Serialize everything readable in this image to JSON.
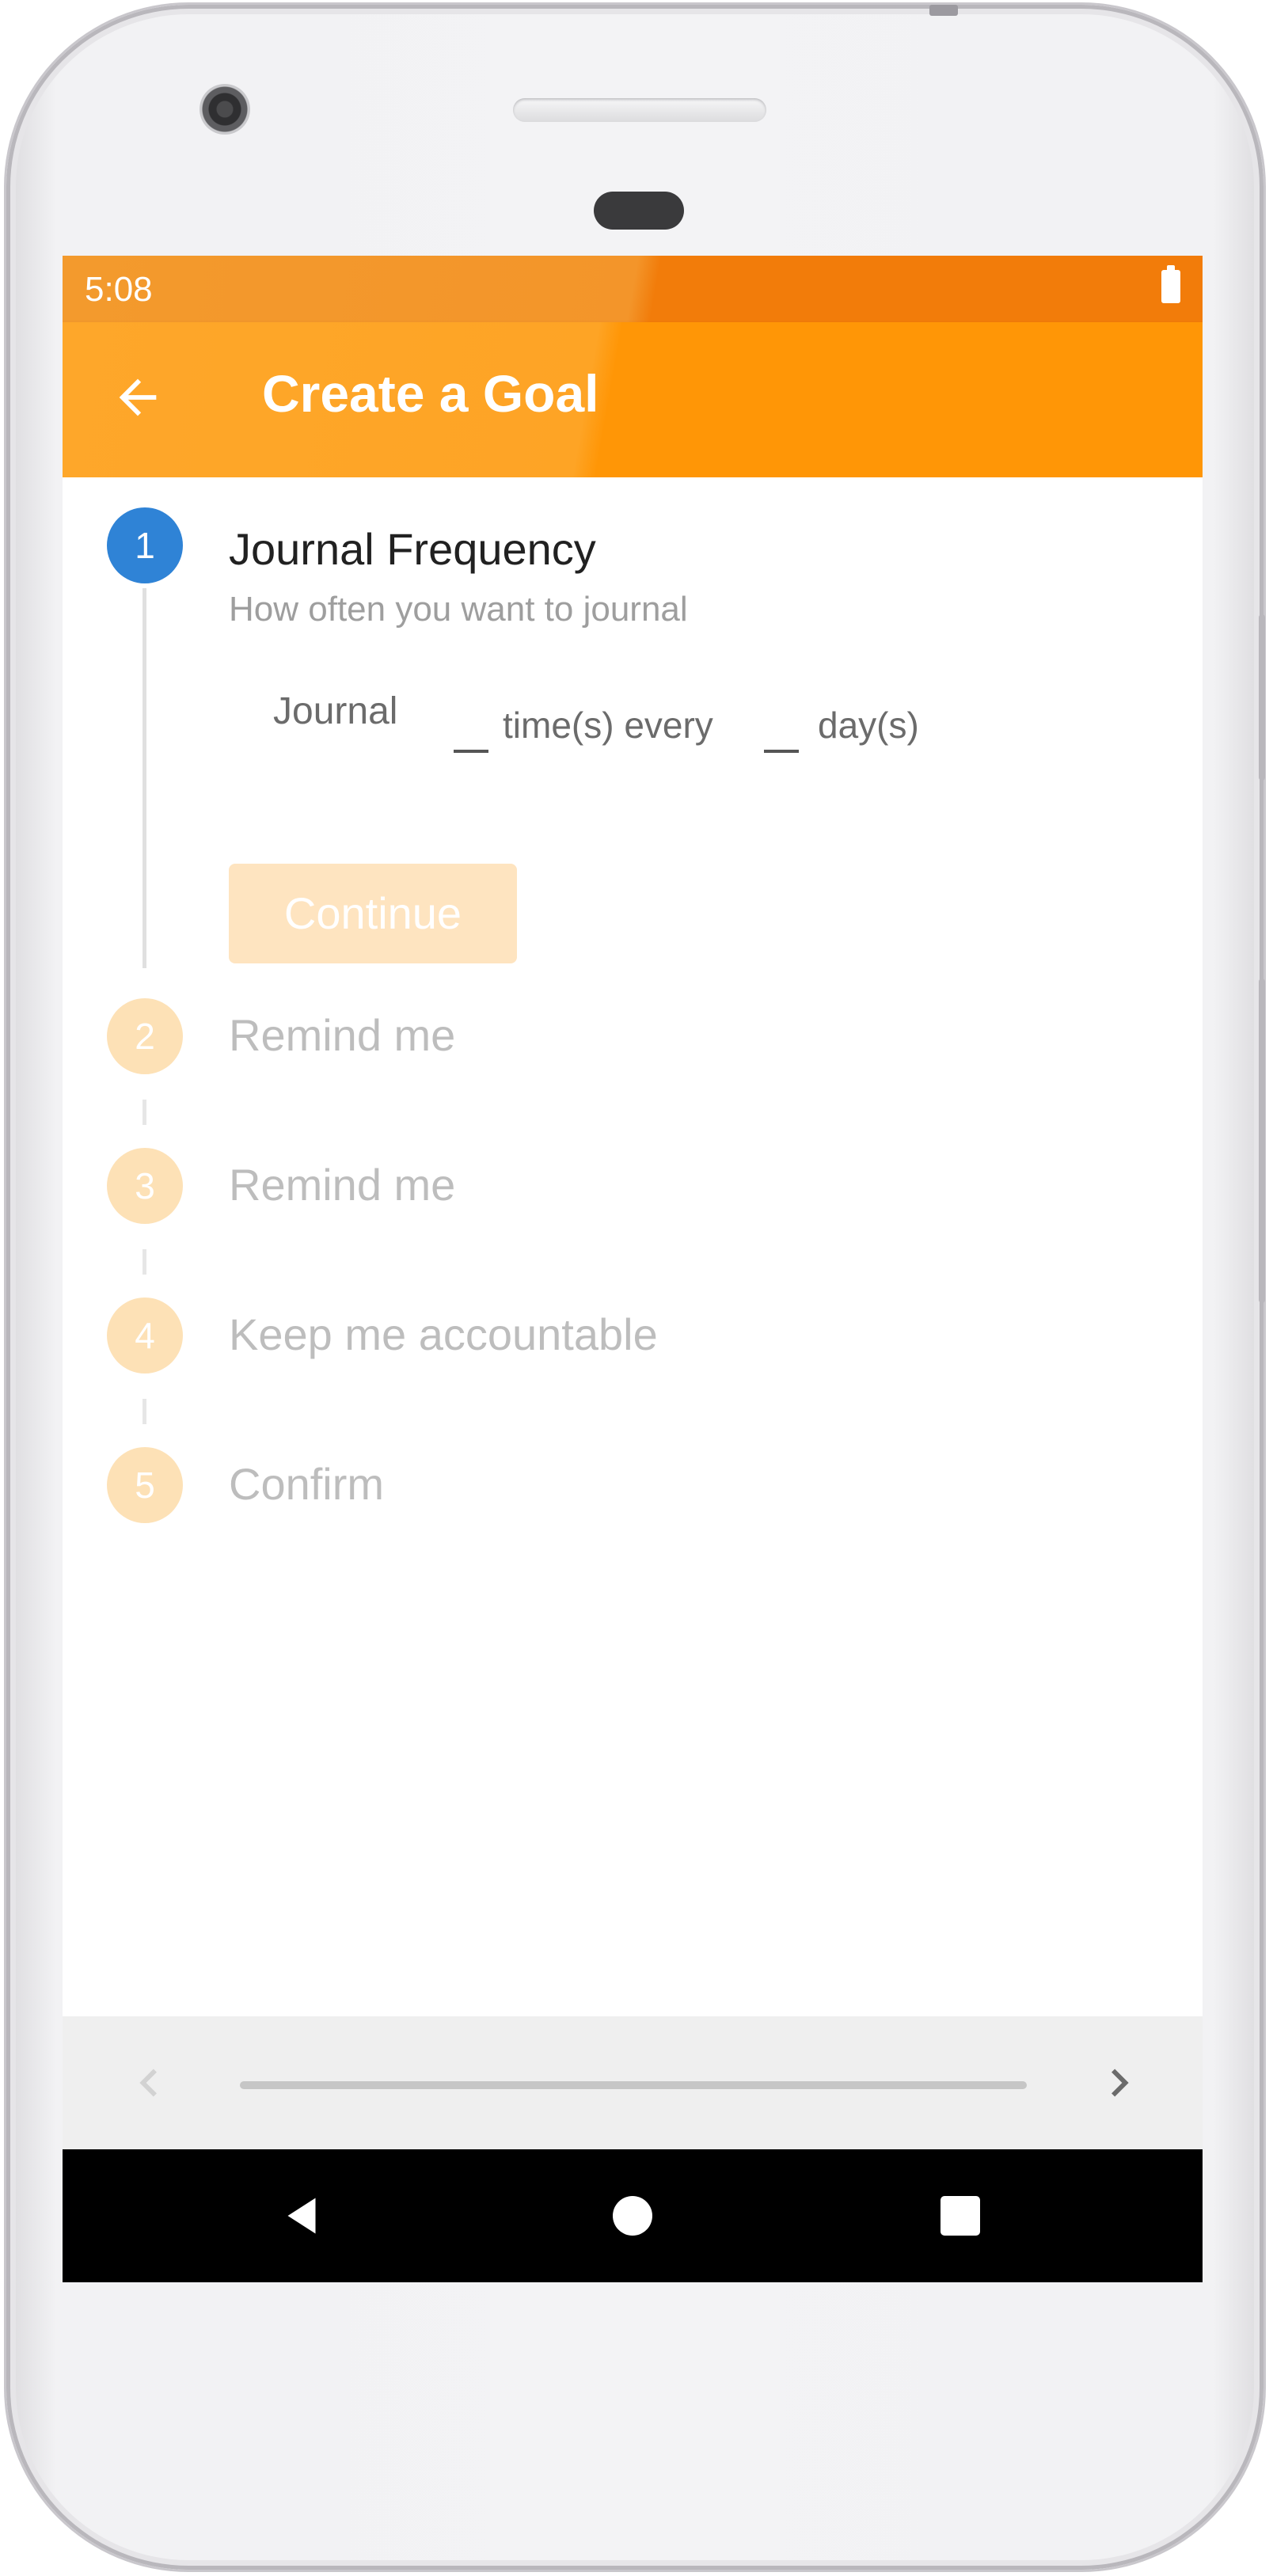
{
  "status_bar": {
    "time": "5:08"
  },
  "app_bar": {
    "title": "Create a Goal"
  },
  "colors": {
    "primary": "#ff9606",
    "primary_light": "#fea72a",
    "status_bar": "#f27c0a",
    "active_step": "#2f83d6",
    "inactive_step": "#fde1b6",
    "continue_disabled": "#fee4c0"
  },
  "stepper": {
    "steps": [
      {
        "number": "1",
        "title": "Journal Frequency",
        "subtitle": "How often you want to journal",
        "state": "active"
      },
      {
        "number": "2",
        "title": "Remind me",
        "state": "inactive"
      },
      {
        "number": "3",
        "title": "Remind me",
        "state": "inactive"
      },
      {
        "number": "4",
        "title": "Keep me accountable",
        "state": "inactive"
      },
      {
        "number": "5",
        "title": "Confirm",
        "state": "inactive"
      }
    ],
    "frequency": {
      "prefix": "Journal",
      "times_value": "",
      "middle": "time(s) every",
      "days_value": "",
      "suffix": "day(s)"
    },
    "continue_label": "Continue"
  },
  "bottom_nav": {
    "prev_icon": "chevron-left-icon",
    "next_icon": "chevron-right-icon",
    "progress": 0
  },
  "system_nav": {
    "back_icon": "triangle-back-icon",
    "home_icon": "circle-home-icon",
    "recents_icon": "square-recents-icon"
  }
}
